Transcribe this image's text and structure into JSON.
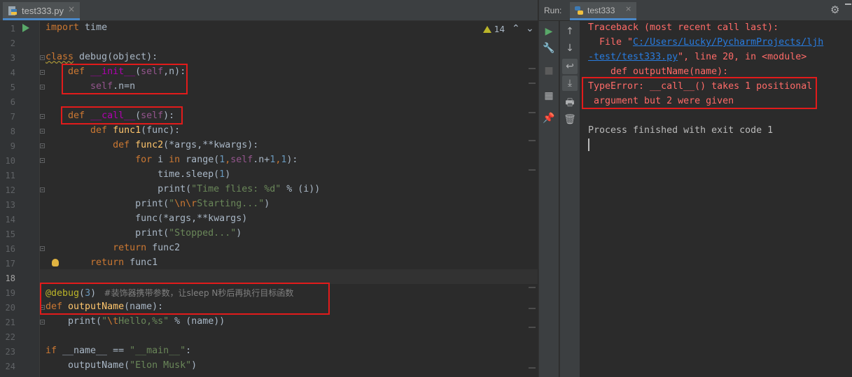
{
  "editor_tab": {
    "filename": "test333.py",
    "close": "×"
  },
  "inspections": {
    "warning_count": "14",
    "prev": "⌃",
    "next": "⌄"
  },
  "line_numbers": [
    "1",
    "2",
    "3",
    "4",
    "5",
    "6",
    "7",
    "8",
    "9",
    "10",
    "11",
    "12",
    "13",
    "14",
    "15",
    "16",
    "17",
    "18",
    "19",
    "20",
    "21",
    "22",
    "23",
    "24"
  ],
  "code": {
    "l1_kw": "import",
    "l1_rest": " time",
    "l3_kw": "class",
    "l3_name": " debug",
    "l3_rest": "(object):",
    "l4_kw": "def",
    "l4_fn": " __init__",
    "l4_p1": "(",
    "l4_self": "self",
    "l4_rest": ",n):",
    "l5_self": "self",
    "l5_rest": ".n=n",
    "l7_kw": "def",
    "l7_fn": " __call__",
    "l7_p": "(",
    "l7_self": "self",
    "l7_rest": "):",
    "l8_kw": "def",
    "l8_fn": " func1",
    "l8_rest": "(func):",
    "l9_kw": "def",
    "l9_fn": " func2",
    "l9_rest": "(*args,**kwargs):",
    "l10_kw1": "for",
    "l10_a": " i ",
    "l10_kw2": "in",
    "l10_b": " range(",
    "l10_n1": "1",
    "l10_c": ",",
    "l10_self": "self",
    "l10_d": ".n+",
    "l10_n2": "1",
    "l10_e": ",",
    "l10_n3": "1",
    "l10_f": "):",
    "l11_a": "time.sleep(",
    "l11_n": "1",
    "l11_b": ")",
    "l12_a": "print(",
    "l12_str": "\"Time flies: %d\"",
    "l12_b": " % (i))",
    "l13_a": "print(",
    "l13_s1": "\"",
    "l13_esc": "\\n\\r",
    "l13_s2": "Starting...\"",
    "l13_b": ")",
    "l14_a": "func(*args,**kwargs)",
    "l15_a": "print(",
    "l15_str": "\"Stopped...\"",
    "l15_b": ")",
    "l16_kw": "return",
    "l16_rest": " func2",
    "l17_kw": "return",
    "l17_rest": " func1",
    "l19_dec": "@debug",
    "l19_a": "(",
    "l19_n": "3",
    "l19_b": ")",
    "l19_cm": "   #装饰器携带参数，让sleep N秒后再执行目标函数",
    "l20_kw": "def",
    "l20_fn": " outputName",
    "l20_rest": "(name):",
    "l21_a": "print(",
    "l21_s1": "\"",
    "l21_esc": "\\t",
    "l21_s2": "Hello,%s\"",
    "l21_b": " % (name))",
    "l23_kw": "if",
    "l23_a": " __name__ == ",
    "l23_str": "\"__main__\"",
    "l23_b": ":",
    "l24_a": "outputName(",
    "l24_str": "\"Elon Musk\"",
    "l24_b": ")"
  },
  "run_panel": {
    "label": "Run:",
    "tab_name": "test333",
    "close": "×",
    "settings_icon": "gear-icon",
    "console": {
      "l1": "Traceback (most recent call last):",
      "l2_pre": "  File \"",
      "l2_link": "C:/Users/Lucky/PycharmProjects/ljh",
      "l3_link": "-test/test333.py",
      "l3_post": "\", line 20, in <module>",
      "l4": "    def outputName(name):",
      "l5": "TypeError: __call__() takes 1 positional",
      "l6": " argument but 2 were given",
      "l7": "Process finished with exit code 1"
    }
  },
  "colors": {
    "error": "#ff6b68",
    "link": "#287bde",
    "highlight_box": "#e21b1b",
    "keyword": "#cc7832"
  }
}
